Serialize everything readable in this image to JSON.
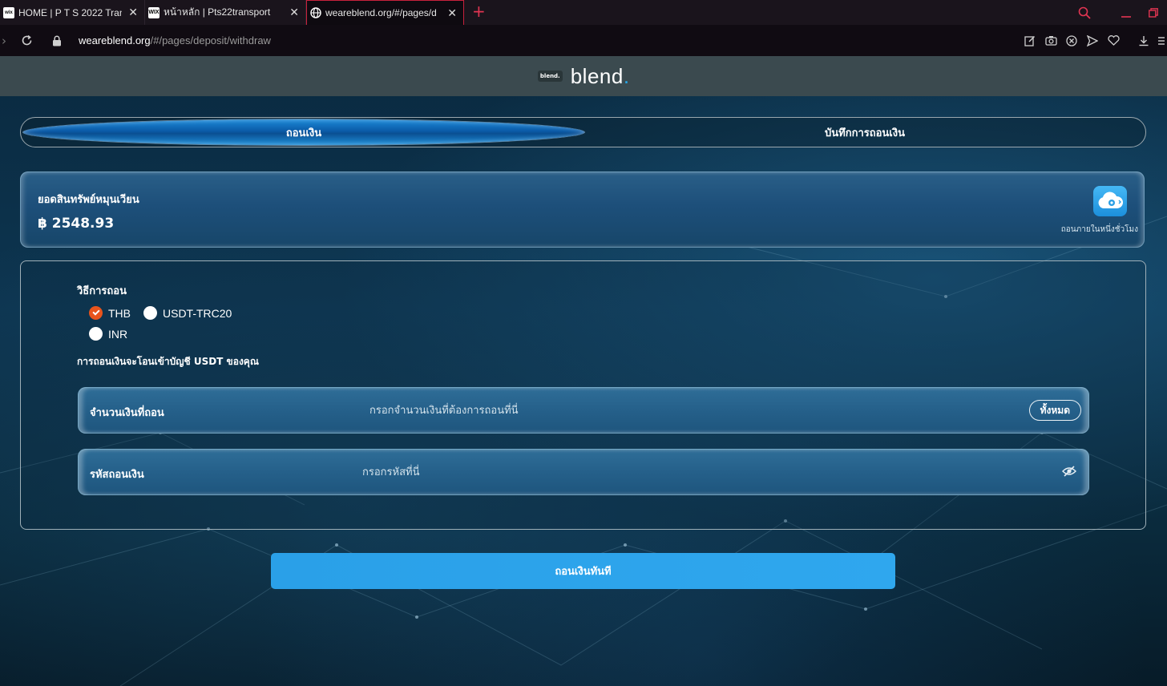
{
  "browser": {
    "tabs": [
      {
        "favicon": "wix",
        "title": "HOME | P T S 2022 Transpo",
        "active": false
      },
      {
        "favicon": "WIX",
        "title": "หน้าหลัก | Pts22transport",
        "active": false
      },
      {
        "favicon": "globe",
        "title": "weareblend.org/#/pages/d",
        "active": true
      }
    ],
    "new_tab_label": "+",
    "url_host": "weareblend.org",
    "url_path": "/#/pages/deposit/withdraw",
    "accent_color": "#e23552"
  },
  "header": {
    "logo_badge": "blend.",
    "logo_text": "blend",
    "logo_dot": "."
  },
  "tabs": {
    "withdraw": "ถอนเงิน",
    "history": "บันทึกการถอนเงิน"
  },
  "balance": {
    "label": "ยอดสินทรัพย์หมุนเวียน",
    "value": "฿ 2548.93",
    "note": "ถอนภายในหนึ่งชั่วโมง"
  },
  "method": {
    "title": "วิธีการถอน",
    "options": [
      {
        "label": "THB",
        "checked": true
      },
      {
        "label": "USDT-TRC20",
        "checked": false
      },
      {
        "label": "INR",
        "checked": false
      }
    ],
    "note": "การถอนเงินจะโอนเข้าบัญชี USDT ของคุณ"
  },
  "amount_field": {
    "label": "จำนวนเงินที่ถอน",
    "placeholder": "กรอกจำนวนเงินที่ต้องการถอนที่นี่",
    "all_button": "ทั้งหมด"
  },
  "password_field": {
    "label": "รหัสถอนเงิน",
    "placeholder": "กรอกรหัสที่นี่"
  },
  "submit_label": "ถอนเงินทันที"
}
